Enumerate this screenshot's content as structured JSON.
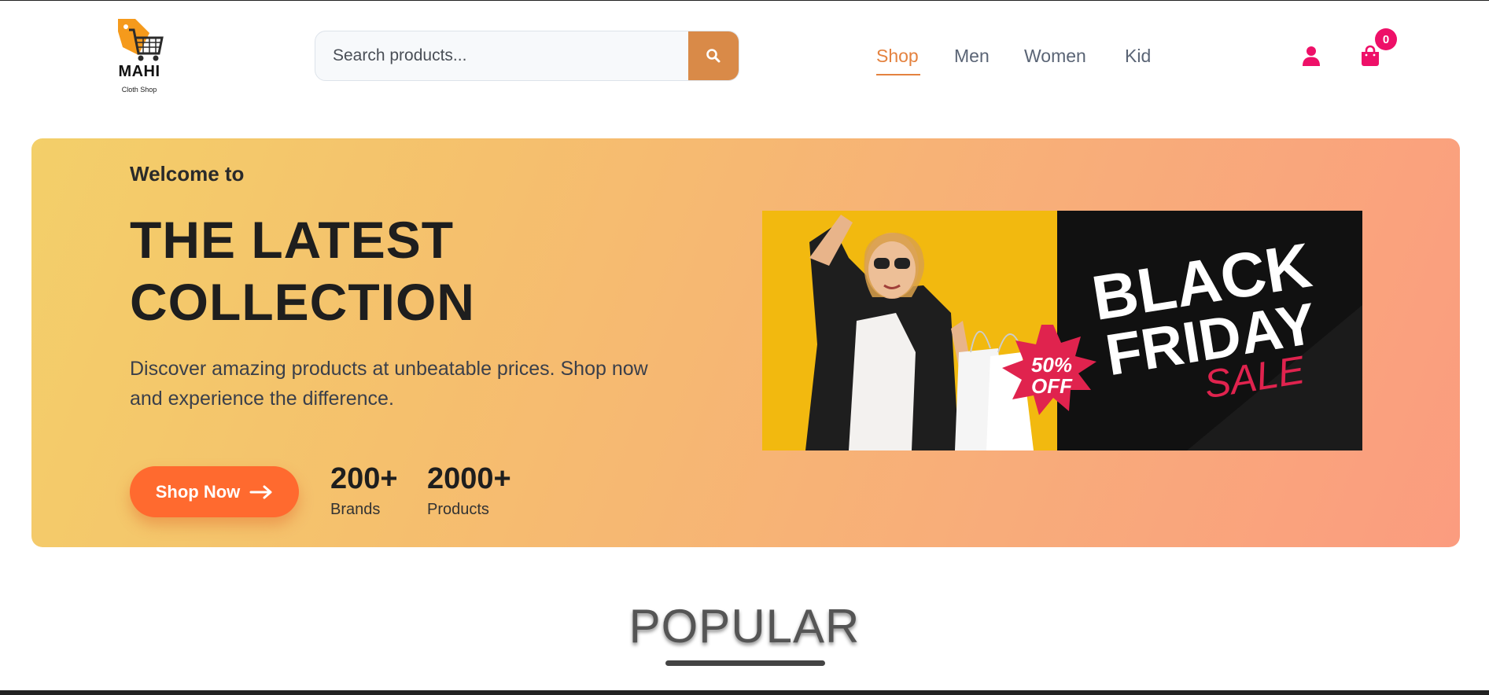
{
  "brand": {
    "name": "MAHI",
    "tagline": "Cloth Shop",
    "logo_icon": "shopping-cart-tag-icon"
  },
  "search": {
    "placeholder": "Search products...",
    "value": "",
    "button_icon": "search-icon"
  },
  "nav": {
    "items": [
      {
        "label": "Shop",
        "active": true
      },
      {
        "label": "Men",
        "active": false
      },
      {
        "label": "Women",
        "active": false
      },
      {
        "label": "Kid",
        "active": false
      }
    ]
  },
  "header_actions": {
    "user_icon": "user-icon",
    "cart_icon": "shopping-bag-icon",
    "cart_count": "0"
  },
  "hero": {
    "welcome": "Welcome to",
    "headline_line1": "THE LATEST",
    "headline_line2": "COLLECTION",
    "description": "Discover amazing products at unbeatable prices. Shop now and experience the difference.",
    "cta_label": "Shop Now",
    "cta_icon": "arrow-right-icon",
    "stats": [
      {
        "value": "200+",
        "label": "Brands"
      },
      {
        "value": "2000+",
        "label": "Products"
      }
    ],
    "promo": {
      "line1": "BLACK",
      "line2": "FRIDAY",
      "line3": "SALE",
      "badge_top": "50%",
      "badge_bottom": "OFF"
    }
  },
  "section": {
    "title": "POPULAR"
  },
  "colors": {
    "accent": "#e4823f",
    "search_button": "#d98a48",
    "cta": "#ff6a2f",
    "icon_pink": "#ee1068",
    "hero_gradient_start": "#f3cf69",
    "hero_gradient_end": "#fb9c7f"
  }
}
